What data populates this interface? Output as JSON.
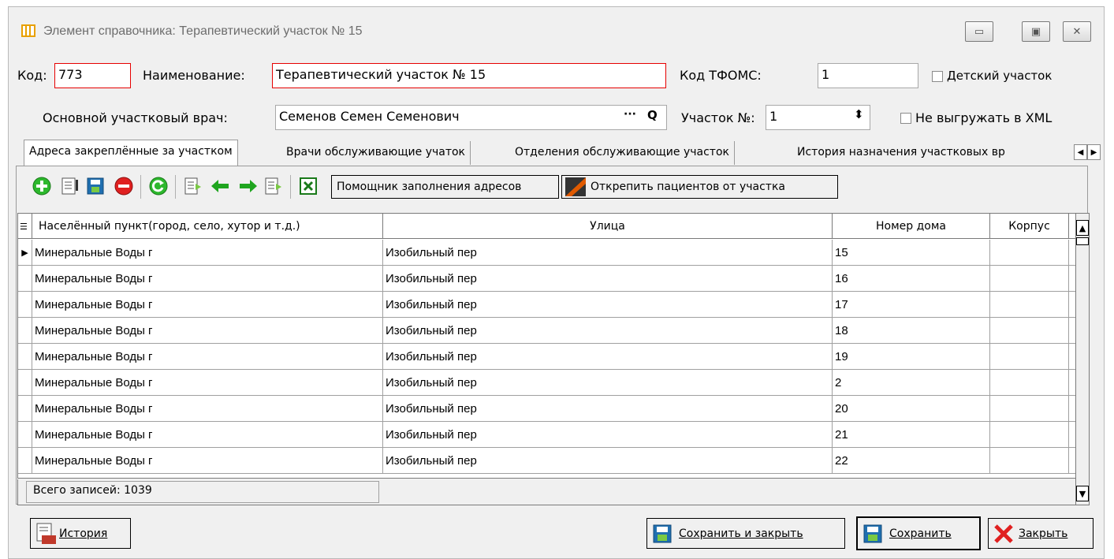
{
  "window": {
    "title": "Элемент справочника: Терапевтический участок № 15",
    "btn_minimize": "▭",
    "btn_restore": "▣",
    "btn_close": "✕"
  },
  "form": {
    "code_label": "Код:",
    "code_value": "773",
    "name_label": "Наименование:",
    "name_value": "Терапевтический участок № 15",
    "tfoms_label": "Код ТФОМС:",
    "tfoms_value": "1",
    "child_label": "Детский участок",
    "doctor_label": "Основной участковый врач:",
    "doctor_value": "Семенов Семен Семенович",
    "ellipsis": "···",
    "search_glyph": "Q",
    "district_label": "Участок №:",
    "district_value": "1",
    "spin_glyph": "⬍",
    "noxml_label": "Не выгружать в XML"
  },
  "tabs": [
    "Адреса закреплённые за участком",
    "Врачи обслуживающие учаток",
    "Отделения обслуживающие участок",
    "История назначения участковых вр"
  ],
  "tab_scroll": {
    "left": "◀",
    "right": "▶"
  },
  "toolbar": {
    "assistant_label": "Помощник заполнения адресов",
    "detach_label": "Открепить пациентов от участка"
  },
  "grid": {
    "columns": [
      "Населённый пункт(город, село, хутор и т.д.)",
      "Улица",
      "Номер дома",
      "Корпус"
    ],
    "rows": [
      [
        "Минеральные Воды г",
        "Изобильный пер",
        "15",
        ""
      ],
      [
        "Минеральные Воды г",
        "Изобильный пер",
        "16",
        ""
      ],
      [
        "Минеральные Воды г",
        "Изобильный пер",
        "17",
        ""
      ],
      [
        "Минеральные Воды г",
        "Изобильный пер",
        "18",
        ""
      ],
      [
        "Минеральные Воды г",
        "Изобильный пер",
        "19",
        ""
      ],
      [
        "Минеральные Воды г",
        "Изобильный пер",
        "2",
        ""
      ],
      [
        "Минеральные Воды г",
        "Изобильный пер",
        "20",
        ""
      ],
      [
        "Минеральные Воды г",
        "Изобильный пер",
        "21",
        ""
      ],
      [
        "Минеральные Воды г",
        "Изобильный пер",
        "22",
        ""
      ]
    ],
    "total_label": "Всего записей: 1039"
  },
  "bottom": {
    "history_label": "История",
    "history_icon_text": "LOG",
    "save_close_label": "Сохранить и закрыть",
    "save_label": "Сохранить",
    "close_label": "Закрыть"
  },
  "colors": {
    "required_border": "#e60000",
    "add_green": "#2db82d",
    "delete_red": "#e02020",
    "arrow_green": "#1fa51f"
  }
}
